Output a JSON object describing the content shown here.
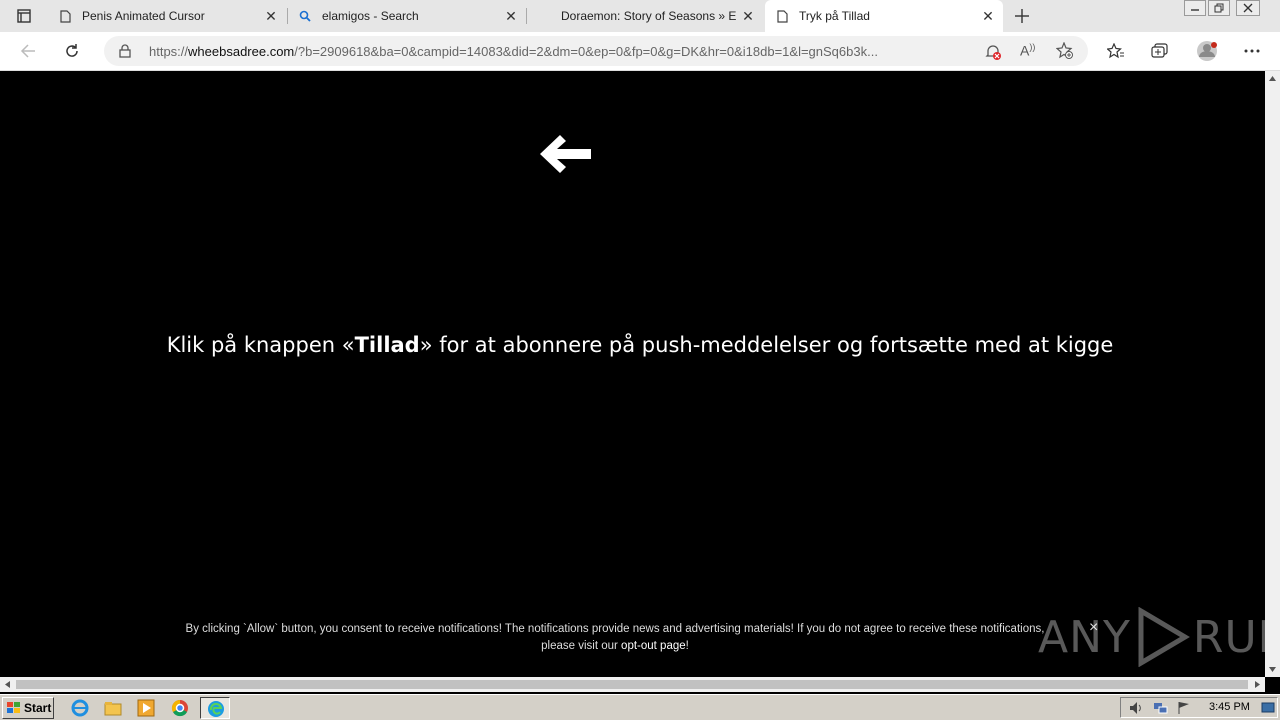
{
  "tabs": [
    {
      "title": "Penis Animated Cursor",
      "icon": "page-icon"
    },
    {
      "title": "elamigos - Search",
      "icon": "search-icon"
    },
    {
      "title": "Doraemon: Story of Seasons » El/",
      "icon": "none"
    },
    {
      "title": "Tryk på Tillad",
      "icon": "page-icon",
      "active": true
    }
  ],
  "address": {
    "scheme": "https://",
    "host": "wheebsadree.com",
    "path": "/?b=2909618&ba=0&campid=14083&did=2&dm=0&ep=0&fp=0&g=DK&hr=0&i18db=1&l=gnSq6b3k..."
  },
  "page": {
    "headline_pre": "Klik på knappen «",
    "headline_bold": "Tillad",
    "headline_post": "» for at abonnere på push-meddelelser og fortsætte med at kigge",
    "consent_line1": "By clicking `Allow` button, you consent to receive notifications! The notifications provide news and advertising materials! If you do not agree to receive these notifications,",
    "consent_line2_pre": "please visit our ",
    "consent_link": "opt-out page",
    "consent_line2_post": "!",
    "close_glyph": "×"
  },
  "watermark": {
    "left": "ANY",
    "right": "RUN"
  },
  "taskbar": {
    "start_label": "Start",
    "clock": "3:45 PM"
  }
}
